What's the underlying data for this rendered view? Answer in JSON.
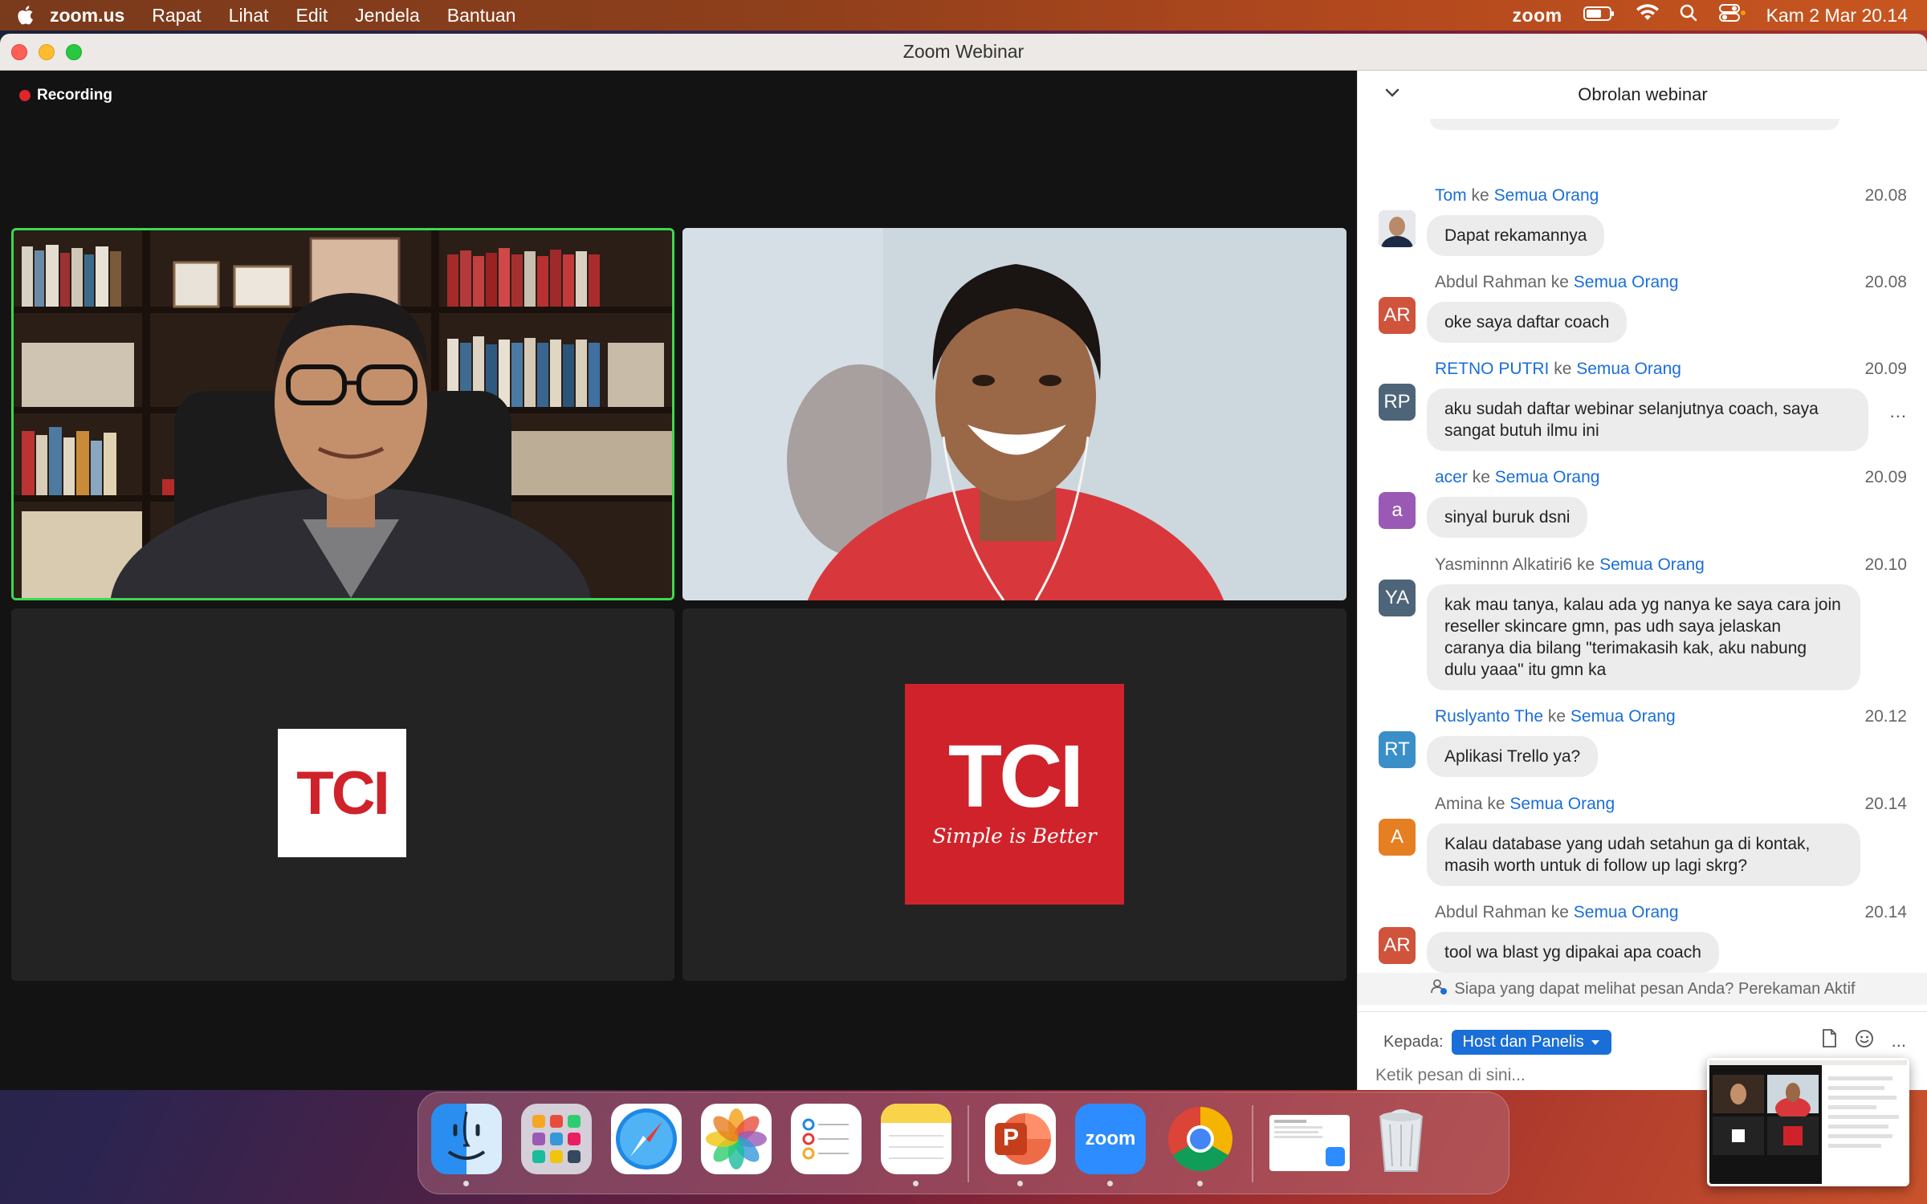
{
  "menubar": {
    "app_name": "zoom.us",
    "items": [
      "Rapat",
      "Lihat",
      "Edit",
      "Jendela",
      "Bantuan"
    ],
    "zoom_label": "zoom",
    "datetime": "Kam 2 Mar  20.14"
  },
  "window": {
    "title": "Zoom Webinar",
    "recording_label": "Recording"
  },
  "tiles": {
    "logo_small_text": "TCI",
    "logo_big_text": "TCI",
    "logo_big_tagline": "Simple is Better"
  },
  "chat": {
    "title": "Obrolan webinar",
    "to_word": "ke",
    "messages": [
      {
        "initials": "",
        "avatar_color": "#5a6a86",
        "sender": "Tom",
        "recipient": "Semua Orang",
        "time": "20.08",
        "text": "Dapat rekamannya"
      },
      {
        "initials": "AR",
        "avatar_color": "#d0533b",
        "sender": "Abdul Rahman",
        "recipient": "Semua Orang",
        "time": "20.08",
        "text": "oke saya daftar coach"
      },
      {
        "initials": "RP",
        "avatar_color": "#4e6478",
        "sender": "RETNO PUTRI",
        "recipient": "Semua Orang",
        "time": "20.09",
        "text": "aku sudah daftar webinar selanjutnya coach, saya sangat butuh ilmu ini"
      },
      {
        "initials": "a",
        "avatar_color": "#9b59b6",
        "sender": "acer",
        "recipient": "Semua Orang",
        "time": "20.09",
        "text": "sinyal buruk dsni"
      },
      {
        "initials": "YA",
        "avatar_color": "#4e6478",
        "sender": "Yasminnn Alkatiri6",
        "recipient": "Semua Orang",
        "time": "20.10",
        "text": "kak mau tanya, kalau ada yg nanya ke saya cara join reseller skincare gmn, pas udh saya jelaskan caranya dia bilang \"terimakasih kak, aku nabung dulu yaaa\" itu gmn ka"
      },
      {
        "initials": "RT",
        "avatar_color": "#3a8fc9",
        "sender": "Ruslyanto The",
        "recipient": "Semua Orang",
        "time": "20.12",
        "text": "Aplikasi Trello ya?"
      },
      {
        "initials": "A",
        "avatar_color": "#e67e22",
        "sender": "Amina",
        "recipient": "Semua Orang",
        "time": "20.14",
        "text": "Kalau database yang udah setahun ga di kontak, masih worth untuk di follow up lagi skrg?"
      },
      {
        "initials": "AR",
        "avatar_color": "#d0533b",
        "sender": "Abdul Rahman",
        "recipient": "Semua Orang",
        "time": "20.14",
        "text": "tool wa blast yg dipakai apa coach"
      }
    ],
    "more_label": "...",
    "privacy_text": "Siapa yang dapat melihat pesan Anda? Perekaman Aktif",
    "to_label": "Kepada:",
    "to_value": "Host dan Panelis",
    "input_placeholder": "Ketik pesan di sini...",
    "more_tools": "..."
  },
  "dock": {
    "icons": [
      "finder-icon",
      "launchpad-icon",
      "safari-icon",
      "photos-icon",
      "reminders-icon",
      "notes-icon",
      "powerpoint-icon",
      "zoom-icon",
      "chrome-icon",
      "document-preview-icon",
      "trash-icon"
    ],
    "zoom_icon_text": "zoom",
    "powerpoint_letter": "P"
  }
}
